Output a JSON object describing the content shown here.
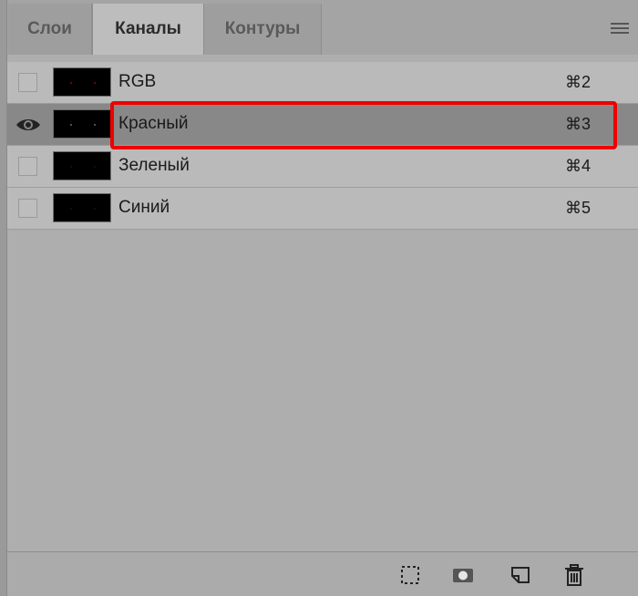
{
  "tabs": [
    {
      "label": "Слои",
      "active": false
    },
    {
      "label": "Каналы",
      "active": true
    },
    {
      "label": "Контуры",
      "active": false
    }
  ],
  "channels": [
    {
      "name": "RGB",
      "shortcut": "⌘2",
      "visible": false,
      "selected": false
    },
    {
      "name": "Красный",
      "shortcut": "⌘3",
      "visible": true,
      "selected": true
    },
    {
      "name": "Зеленый",
      "shortcut": "⌘4",
      "visible": false,
      "selected": false
    },
    {
      "name": "Синий",
      "shortcut": "⌘5",
      "visible": false,
      "selected": false
    }
  ],
  "icons": {
    "panel_menu": "hamburger-menu-icon",
    "visibility": "eye-icon",
    "load_selection": "dotted-selection-icon",
    "save_selection": "mask-icon",
    "new_channel": "new-channel-icon",
    "delete": "trash-icon"
  },
  "colors": {
    "highlight": "#ee0000",
    "selected_row": "#888888",
    "row": "#bababa"
  }
}
